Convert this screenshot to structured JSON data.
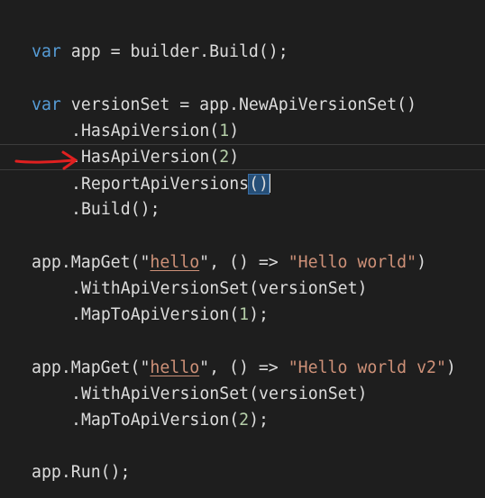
{
  "editor": {
    "lines": {
      "build_app": {
        "kw": "var",
        "rest": " app = builder.Build();"
      },
      "version_set": {
        "kw": "var",
        "rest": " versionSet = app.NewApiVersionSet()"
      },
      "has_v1": {
        "pre": ".HasApiVersion(",
        "num": "1",
        "post": ")"
      },
      "has_v2": {
        "pre": ".HasApiVersion(",
        "num": "2",
        "post": ")"
      },
      "report": {
        "pre": ".ReportApiVersions",
        "paren": "()"
      },
      "build": ".Build();",
      "mapget1": {
        "pre": "app.MapGet(\"",
        "route": "hello",
        "mid": "\", () => ",
        "result": "\"Hello world\"",
        "post": ")"
      },
      "with_set1": ".WithApiVersionSet(versionSet)",
      "map_v1": {
        "pre": ".MapToApiVersion(",
        "num": "1",
        "post": ");"
      },
      "mapget2": {
        "pre": "app.MapGet(\"",
        "route": "hello",
        "mid": "\", () => ",
        "result": "\"Hello world v2\"",
        "post": ")"
      },
      "with_set2": ".WithApiVersionSet(versionSet)",
      "map_v2": {
        "pre": ".MapToApiVersion(",
        "num": "2",
        "post": ");"
      },
      "run": "app.Run();"
    },
    "colors": {
      "background": "#1e1e1e",
      "keyword": "#569cd6",
      "number": "#b5cea8",
      "string": "#ce9178",
      "annotation_arrow": "#e02020"
    },
    "annotation": "red-arrow-pointing-at-report-line"
  }
}
